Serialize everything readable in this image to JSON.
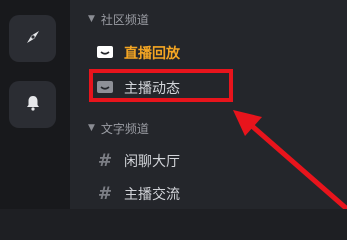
{
  "sidebar": {
    "items": [
      {
        "icon": "compass-icon"
      },
      {
        "icon": "bell-icon"
      }
    ]
  },
  "channel_list": {
    "categories": [
      {
        "label": "社区频道",
        "channels": [
          {
            "label": "直播回放",
            "icon": "chat-bubble-icon",
            "active": true
          },
          {
            "label": "主播动态",
            "icon": "chat-bubble-icon",
            "active": false
          }
        ]
      },
      {
        "label": "文字频道",
        "channels": [
          {
            "label": "闲聊大厅",
            "icon": "hash-icon"
          },
          {
            "label": "主播交流",
            "icon": "hash-icon"
          }
        ]
      }
    ]
  },
  "colors": {
    "accent": "#f5a623",
    "highlight": "#e8141c",
    "background": "#24262b"
  }
}
